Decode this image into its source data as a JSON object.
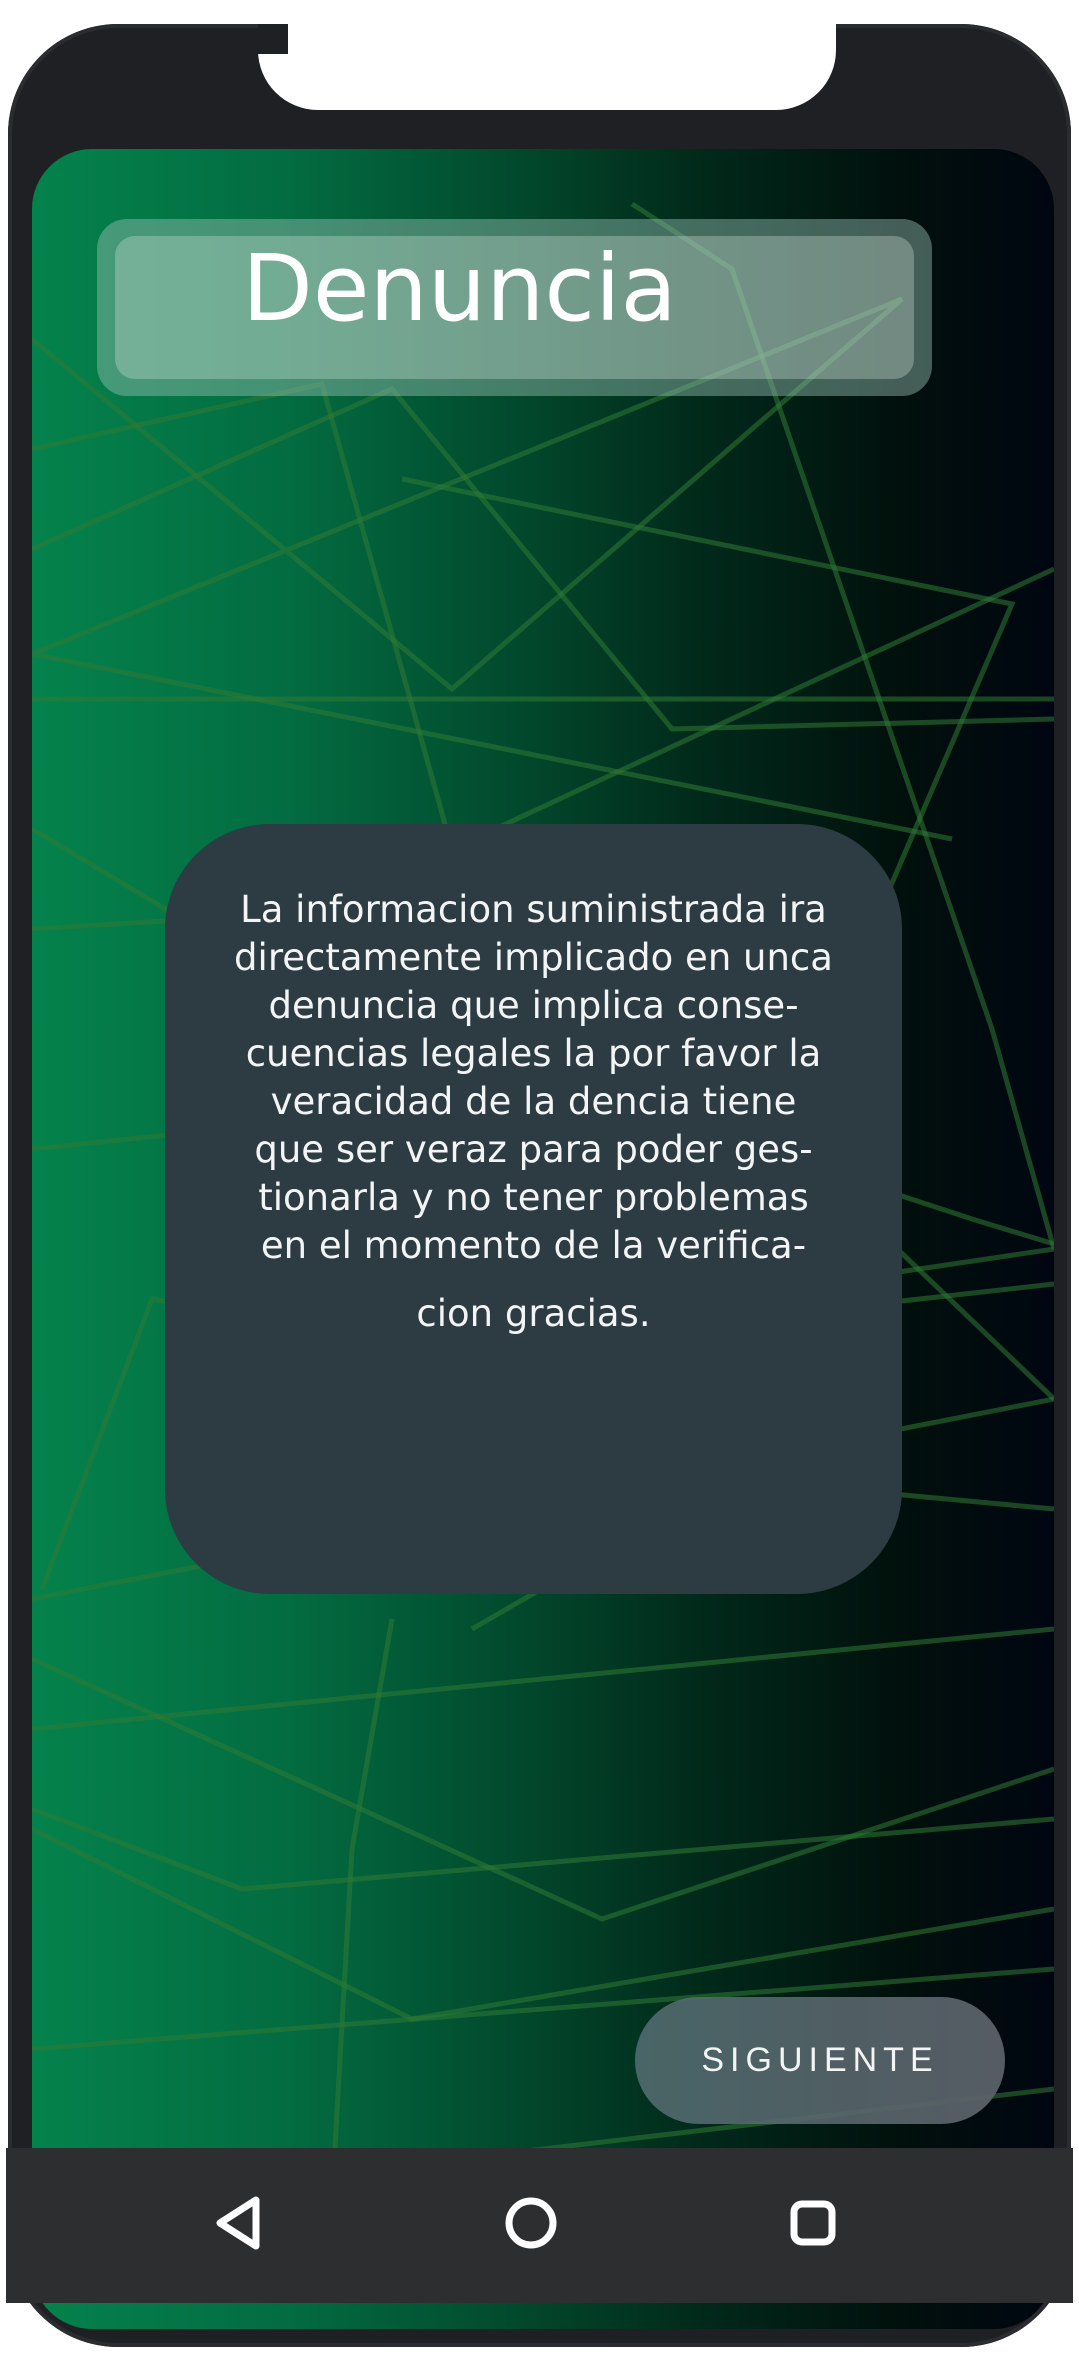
{
  "header": {
    "title": "Denuncia"
  },
  "notice": {
    "lines": [
      "La informacion suministrada ira",
      "directamente implicado en unca",
      "denuncia que implica conse-",
      "cuencias legales la por favor la",
      "veracidad de la dencia tiene",
      "que ser veraz para poder ges-",
      "tionarla y no tener problemas",
      "en el momento de la verifica-",
      "cion gracias."
    ]
  },
  "actions": {
    "next_label": "SIGUIENTE"
  },
  "navigation": {
    "icons": [
      "back-icon",
      "home-icon",
      "recents-icon"
    ]
  },
  "colors": {
    "gradient_start": "#04824c",
    "gradient_end": "#000611",
    "card_bg": "#2d3b42",
    "frame": "#1f2023"
  }
}
